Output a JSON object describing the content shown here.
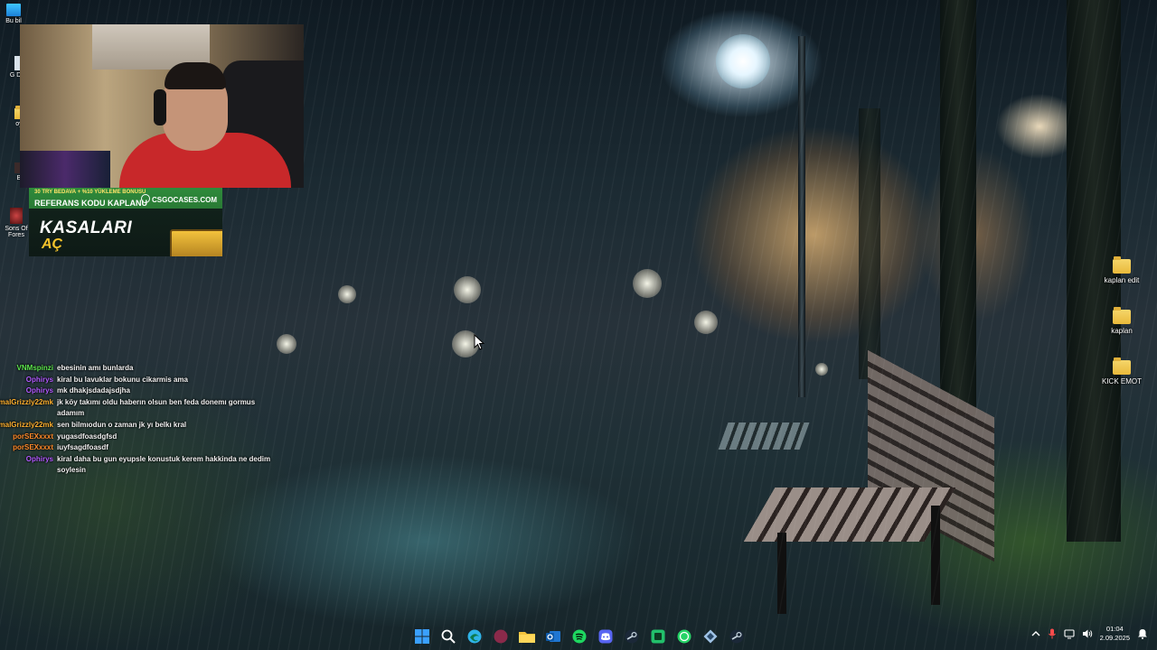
{
  "desktop": {
    "left_icons": [
      {
        "label": "Bu bil",
        "icon": "monitor-icon"
      },
      {
        "label": "G Dön",
        "icon": "app-icon"
      },
      {
        "label": "oy",
        "icon": "folder-icon"
      },
      {
        "label": "B",
        "icon": "game-icon"
      },
      {
        "label": "Sons Of Fores",
        "icon": "game-icon"
      }
    ],
    "right_icons": [
      {
        "label": "kaplan edit",
        "icon": "folder-icon"
      },
      {
        "label": "kaplan",
        "icon": "folder-icon"
      },
      {
        "label": "KICK EMOT",
        "icon": "folder-icon"
      }
    ]
  },
  "ad": {
    "bonus_line": "30 TRY BEDAVA + %10 YÜKLEME BONUSU",
    "referral": "REFERANS KODU KAPLANU",
    "brand": "CSGOCASES.COM",
    "title_line1": "KASALARI",
    "title_line2": "AÇ"
  },
  "chat": {
    "messages": [
      {
        "user": "VNMspinzi",
        "color": "#5ee84f",
        "text": "ebesinin amı bunlarda"
      },
      {
        "user": "Ophirys",
        "color": "#b25cff",
        "text": "kiral bu lavuklar bokunu cikarmis ama"
      },
      {
        "user": "Ophirys",
        "color": "#b25cff",
        "text": "mk dhakjsdadajsdjha"
      },
      {
        "user": "malGrizzly22mk",
        "color": "#ffb02e",
        "text": "jk köy takımı oldu haberın olsun ben feda donemı gormus adamım"
      },
      {
        "user": "malGrizzly22mk",
        "color": "#ffb02e",
        "text": "sen bilmıodun o zaman jk yı belkı kral"
      },
      {
        "user": "porSEXxxxt",
        "color": "#ff8a2a",
        "text": "yugasdfoasdgfsd"
      },
      {
        "user": "porSEXxxxt",
        "color": "#ff8a2a",
        "text": "iuyfsagdfoasdf"
      },
      {
        "user": "Ophirys",
        "color": "#b25cff",
        "text": "kiral daha bu gun eyupsle konustuk kerem hakkinda ne dedim soylesin"
      }
    ]
  },
  "taskbar": {
    "apps": [
      {
        "name": "start-button",
        "icon": "windows-icon",
        "color": "#3aa0ff"
      },
      {
        "name": "search-button",
        "icon": "search-icon",
        "color": "#ffffff"
      },
      {
        "name": "edge-button",
        "icon": "edge-icon",
        "color": "#2fb4e8"
      },
      {
        "name": "app-button",
        "icon": "circle-app-icon",
        "color": "#8a2a4a"
      },
      {
        "name": "file-explorer-button",
        "icon": "folder-icon",
        "color": "#f3c23c"
      },
      {
        "name": "outlook-button",
        "icon": "outlook-icon",
        "color": "#1f76d2"
      },
      {
        "name": "spotify-button",
        "icon": "spotify-icon",
        "color": "#1ed760"
      },
      {
        "name": "discord-button",
        "icon": "discord-icon",
        "color": "#5865f2"
      },
      {
        "name": "steam-button",
        "icon": "steam-icon",
        "color": "#c7d5e0"
      },
      {
        "name": "green-app-button",
        "icon": "green-app-icon",
        "color": "#22c06b"
      },
      {
        "name": "whatsapp-button",
        "icon": "whatsapp-icon",
        "color": "#25d366"
      },
      {
        "name": "game-app-button",
        "icon": "game-app-icon",
        "color": "#9fc3e6"
      },
      {
        "name": "steam2-button",
        "icon": "steam-icon",
        "color": "#c7d5e0"
      }
    ],
    "time": "01:04",
    "date": "2.09.2025"
  }
}
